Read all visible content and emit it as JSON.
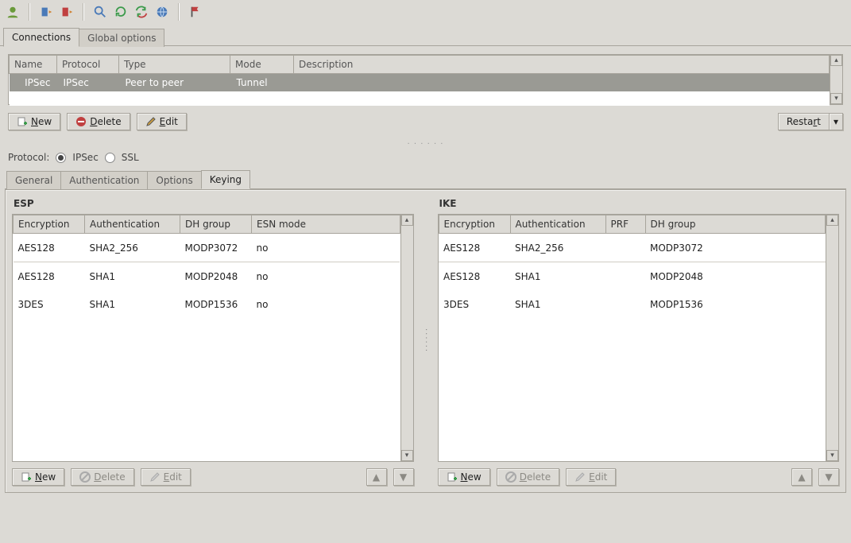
{
  "toolbar_icons": [
    "user-icon",
    "import-icon",
    "export-icon",
    "search-icon",
    "refresh-icon",
    "sync-icon",
    "globe-icon",
    "flag-icon"
  ],
  "main_tabs": {
    "items": [
      "Connections",
      "Global options"
    ],
    "active": 0
  },
  "conn_table": {
    "headers": [
      "Name",
      "Protocol",
      "Type",
      "Mode",
      "Description"
    ],
    "row": {
      "name": "IPSec",
      "protocol": "IPSec",
      "type": "Peer to peer",
      "mode": "Tunnel",
      "description": ""
    }
  },
  "conn_buttons": {
    "new": "New",
    "delete": "Delete",
    "edit": "Edit",
    "restart": "Restart"
  },
  "protocol_row": {
    "label": "Protocol:",
    "opt1": "IPSec",
    "opt2": "SSL",
    "selected": "IPSec"
  },
  "sub_tabs": {
    "items": [
      "General",
      "Authentication",
      "Options",
      "Keying"
    ],
    "active": 3
  },
  "esp": {
    "title": "ESP",
    "headers": [
      "Encryption",
      "Authentication",
      "DH group",
      "ESN mode"
    ],
    "rows": [
      {
        "enc": "AES128",
        "auth": "SHA2_256",
        "dh": "MODP3072",
        "esn": "no"
      },
      {
        "enc": "AES128",
        "auth": "SHA1",
        "dh": "MODP2048",
        "esn": "no"
      },
      {
        "enc": "3DES",
        "auth": "SHA1",
        "dh": "MODP1536",
        "esn": "no"
      }
    ]
  },
  "ike": {
    "title": "IKE",
    "headers": [
      "Encryption",
      "Authentication",
      "PRF",
      "DH group"
    ],
    "rows": [
      {
        "enc": "AES128",
        "auth": "SHA2_256",
        "prf": "",
        "dh": "MODP3072"
      },
      {
        "enc": "AES128",
        "auth": "SHA1",
        "prf": "",
        "dh": "MODP2048"
      },
      {
        "enc": "3DES",
        "auth": "SHA1",
        "prf": "",
        "dh": "MODP1536"
      }
    ]
  },
  "key_buttons": {
    "new": "New",
    "delete": "Delete",
    "edit": "Edit"
  }
}
